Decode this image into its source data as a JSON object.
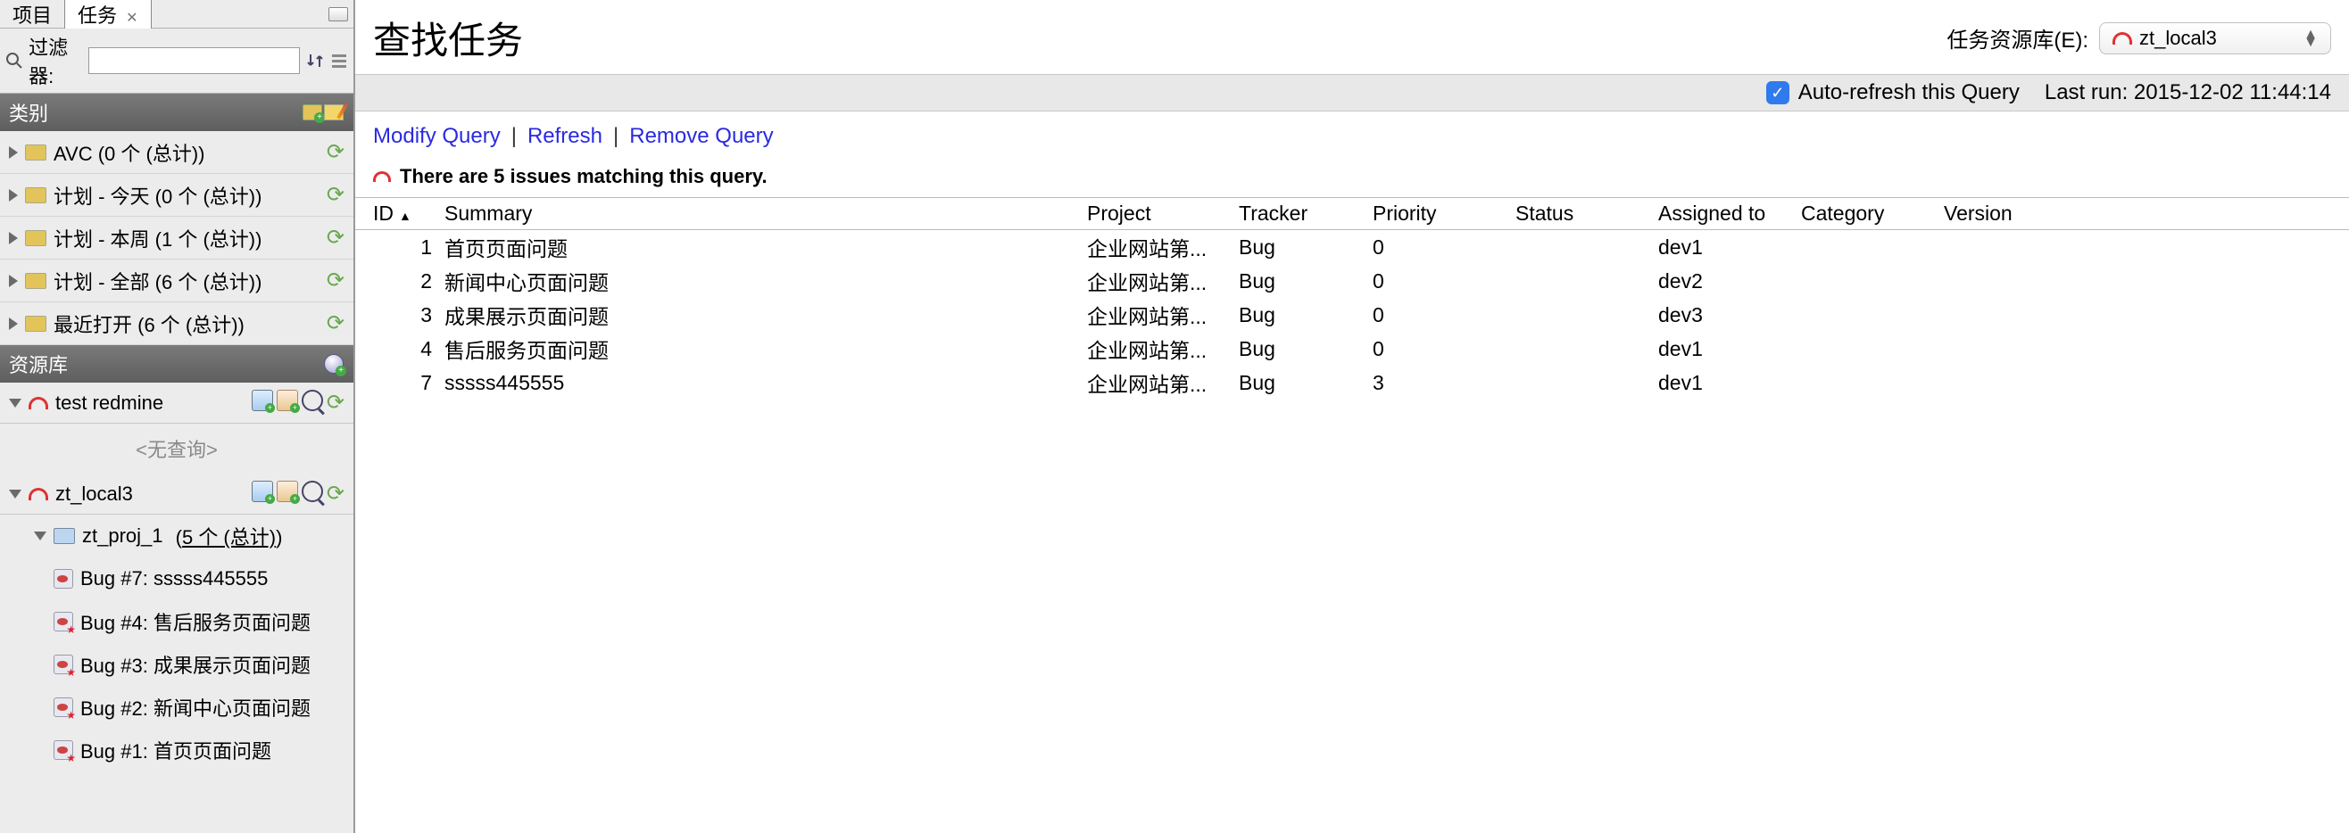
{
  "tabs": {
    "project": "项目",
    "tasks": "任务"
  },
  "filter": {
    "label": "过滤器:",
    "value": ""
  },
  "section_categories": "类别",
  "categories": [
    {
      "label": "AVC  (0 个 (总计))"
    },
    {
      "label": "计划 - 今天  (0 个 (总计))"
    },
    {
      "label": "计划 - 本周  (1 个 (总计))"
    },
    {
      "label": "计划 - 全部  (6 个 (总计))"
    },
    {
      "label": "最近打开  (6 个 (总计))"
    }
  ],
  "section_repos": "资源库",
  "repos": {
    "r1": {
      "name": "test redmine",
      "noquery": "<无查询>"
    },
    "r2": {
      "name": "zt_local3",
      "proj": {
        "name": "zt_proj_1",
        "count_label": "5 个 (总计)"
      },
      "bugs": [
        "Bug #7: sssss445555",
        "Bug #4: 售后服务页面问题",
        "Bug #3: 成果展示页面问题",
        "Bug #2: 新闻中心页面问题",
        "Bug #1: 首页页面问题"
      ]
    }
  },
  "main": {
    "title": "查找任务",
    "repo_label": "任务资源库(E):",
    "repo_selected": "zt_local3",
    "autorefresh": "Auto-refresh this Query",
    "lastrun_label": "Last run:",
    "lastrun_value": "2015-12-02 11:44:14",
    "links": {
      "modify": "Modify Query",
      "refresh": "Refresh",
      "remove": "Remove Query"
    },
    "match_msg": "There are 5 issues matching this query.",
    "cols": {
      "id": "ID",
      "summary": "Summary",
      "project": "Project",
      "tracker": "Tracker",
      "priority": "Priority",
      "status": "Status",
      "assigned": "Assigned to",
      "category": "Category",
      "version": "Version"
    },
    "rows": [
      {
        "id": "1",
        "summary": "首页页面问题",
        "project": "企业网站第...",
        "tracker": "Bug",
        "priority": "0",
        "status": "",
        "assigned": "dev1",
        "category": "",
        "version": ""
      },
      {
        "id": "2",
        "summary": "新闻中心页面问题",
        "project": "企业网站第...",
        "tracker": "Bug",
        "priority": "0",
        "status": "",
        "assigned": "dev2",
        "category": "",
        "version": ""
      },
      {
        "id": "3",
        "summary": "成果展示页面问题",
        "project": "企业网站第...",
        "tracker": "Bug",
        "priority": "0",
        "status": "",
        "assigned": "dev3",
        "category": "",
        "version": ""
      },
      {
        "id": "4",
        "summary": "售后服务页面问题",
        "project": "企业网站第...",
        "tracker": "Bug",
        "priority": "0",
        "status": "",
        "assigned": "dev1",
        "category": "",
        "version": ""
      },
      {
        "id": "7",
        "summary": "sssss445555",
        "project": "企业网站第...",
        "tracker": "Bug",
        "priority": "3",
        "status": "",
        "assigned": "dev1",
        "category": "",
        "version": ""
      }
    ]
  }
}
